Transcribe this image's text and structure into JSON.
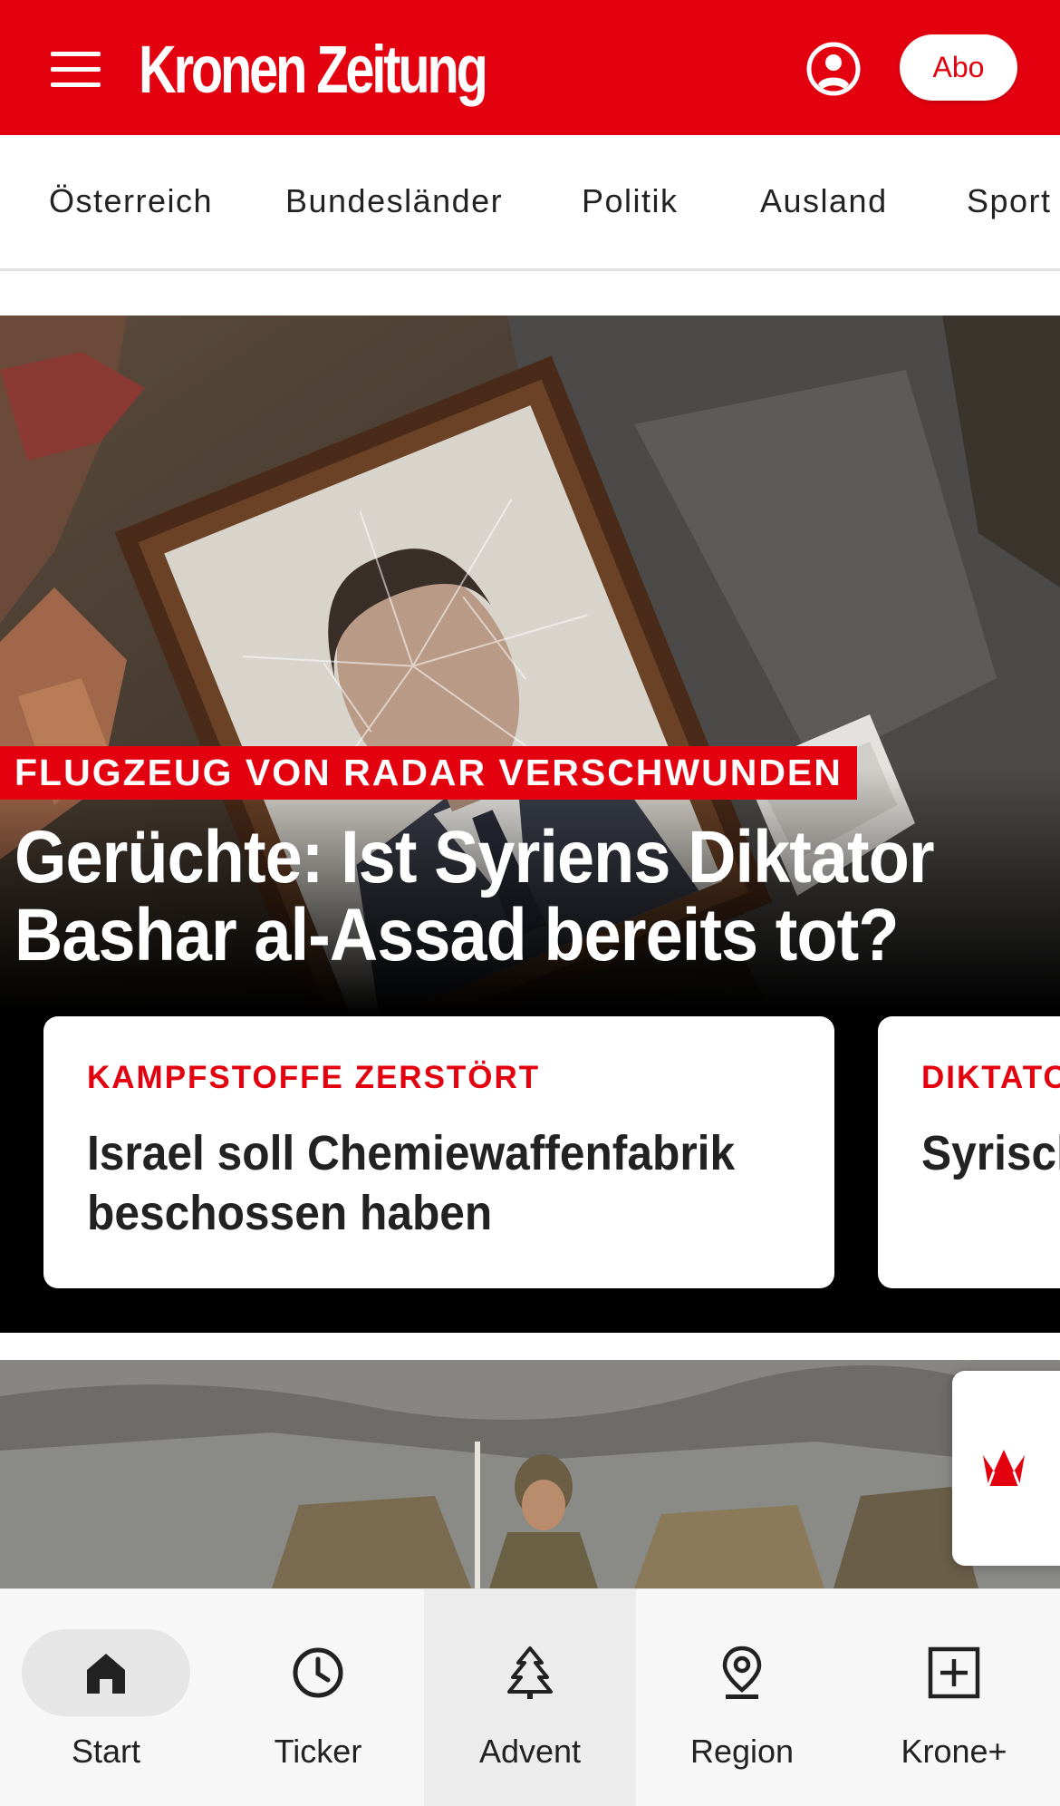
{
  "header": {
    "logo_text": "Kronen Zeitung",
    "abo_label": "Abo",
    "brand_color": "#e3000f"
  },
  "category_nav": {
    "items": [
      "Österreich",
      "Bundesländer",
      "Politik",
      "Ausland",
      "Sport"
    ]
  },
  "hero": {
    "kicker": "FLUGZEUG VON RADAR VERSCHWUNDEN",
    "title": "Gerüchte: Ist Syriens Diktator Bashar al-Assad bereits tot?",
    "cards": [
      {
        "kicker": "KAMPFSTOFFE ZERSTÖRT",
        "title": "Israel soll Chemiewaffenfabrik beschossen haben"
      },
      {
        "kicker": "DIKTATO",
        "title": "Syrisch Assad"
      }
    ]
  },
  "bottom_nav": {
    "tabs": [
      {
        "label": "Start",
        "icon": "home-icon",
        "active": true
      },
      {
        "label": "Ticker",
        "icon": "clock-icon",
        "active": false
      },
      {
        "label": "Advent",
        "icon": "tree-icon",
        "active": false
      },
      {
        "label": "Region",
        "icon": "location-pin-icon",
        "active": false
      },
      {
        "label": "Krone+",
        "icon": "plus-box-icon",
        "active": false
      }
    ]
  }
}
